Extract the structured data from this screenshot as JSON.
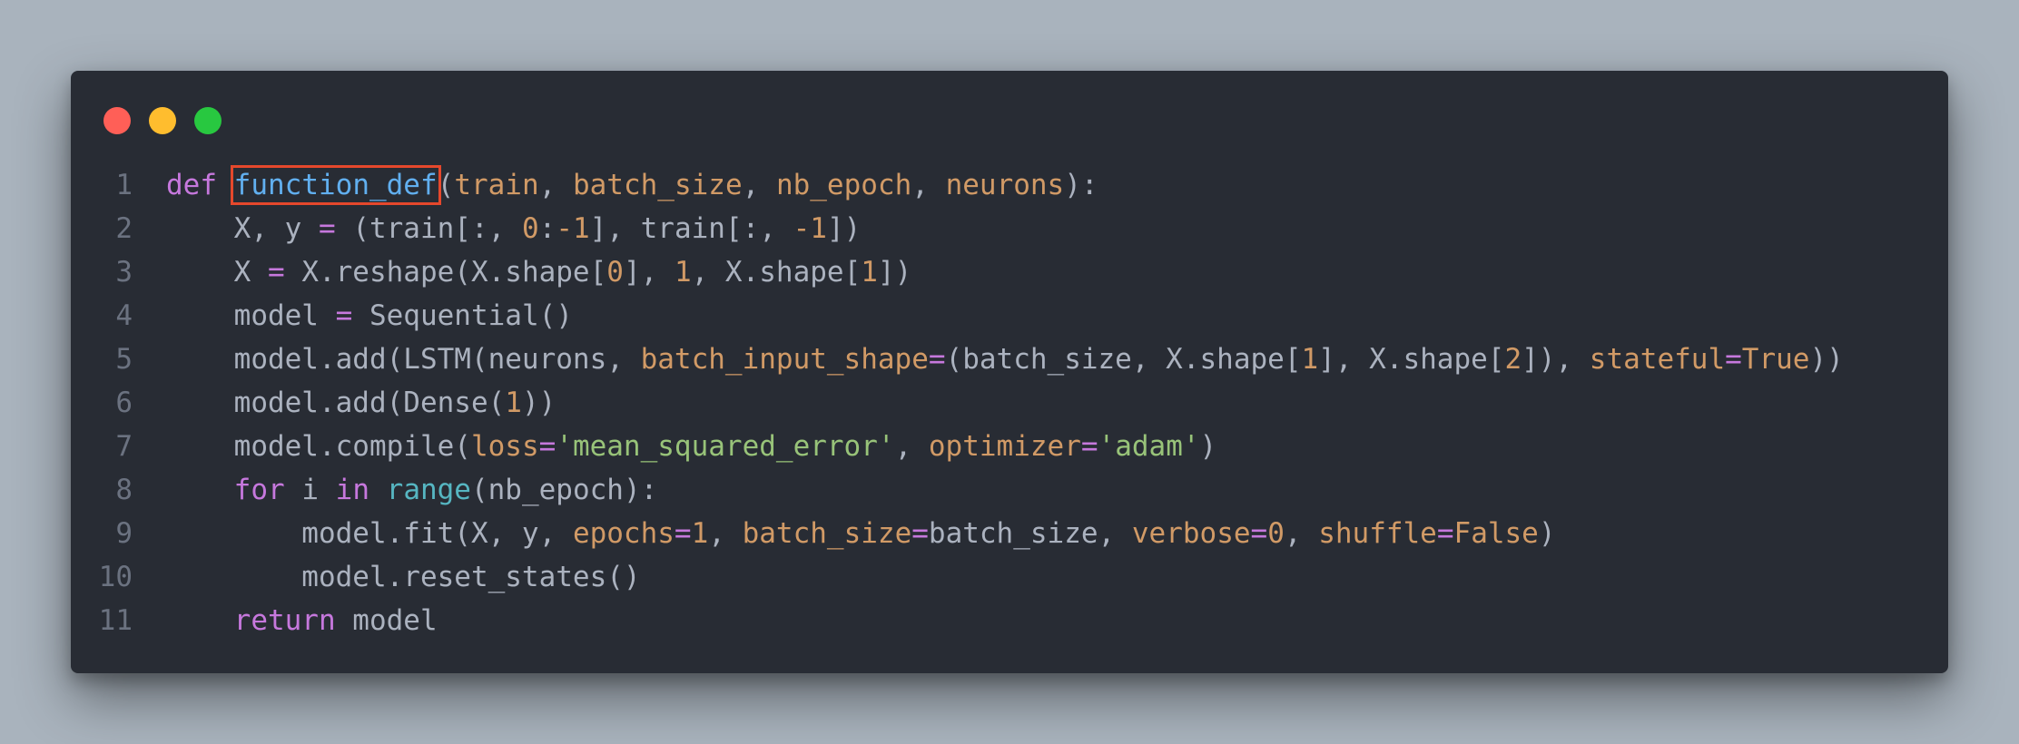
{
  "window": {
    "controls": [
      "close",
      "minimize",
      "maximize"
    ],
    "colors": {
      "close": "#ff5f57",
      "minimize": "#ffbd2e",
      "maximize": "#28c840",
      "background": "#282c34",
      "highlight_box": "#e5482c"
    }
  },
  "code": {
    "highlighted_token": "function_def",
    "lines": [
      {
        "n": "1",
        "tokens": [
          {
            "t": "def",
            "k": "kw"
          },
          {
            "t": " "
          },
          {
            "t": "function_def",
            "k": "fn",
            "hl": true
          },
          {
            "t": "("
          },
          {
            "t": "train",
            "k": "pa"
          },
          {
            "t": ", "
          },
          {
            "t": "batch_size",
            "k": "pa"
          },
          {
            "t": ", "
          },
          {
            "t": "nb_epoch",
            "k": "pa"
          },
          {
            "t": ", "
          },
          {
            "t": "neurons",
            "k": "pa"
          },
          {
            "t": "):"
          }
        ]
      },
      {
        "n": "2",
        "tokens": [
          {
            "t": "    X, y "
          },
          {
            "t": "=",
            "k": "op"
          },
          {
            "t": " (train[:, "
          },
          {
            "t": "0",
            "k": "nu"
          },
          {
            "t": ":"
          },
          {
            "t": "-1",
            "k": "nu"
          },
          {
            "t": "], train[:, "
          },
          {
            "t": "-1",
            "k": "nu"
          },
          {
            "t": "])"
          }
        ]
      },
      {
        "n": "3",
        "tokens": [
          {
            "t": "    X "
          },
          {
            "t": "=",
            "k": "op"
          },
          {
            "t": " X.reshape(X.shape["
          },
          {
            "t": "0",
            "k": "nu"
          },
          {
            "t": "], "
          },
          {
            "t": "1",
            "k": "nu"
          },
          {
            "t": ", X.shape["
          },
          {
            "t": "1",
            "k": "nu"
          },
          {
            "t": "])"
          }
        ]
      },
      {
        "n": "4",
        "tokens": [
          {
            "t": "    model "
          },
          {
            "t": "=",
            "k": "op"
          },
          {
            "t": " Sequential()"
          }
        ]
      },
      {
        "n": "5",
        "tokens": [
          {
            "t": "    model.add(LSTM(neurons, "
          },
          {
            "t": "batch_input_shape",
            "k": "pa"
          },
          {
            "t": "=",
            "k": "op"
          },
          {
            "t": "(batch_size, X.shape["
          },
          {
            "t": "1",
            "k": "nu"
          },
          {
            "t": "], X.shape["
          },
          {
            "t": "2",
            "k": "nu"
          },
          {
            "t": "]), "
          },
          {
            "t": "stateful",
            "k": "pa"
          },
          {
            "t": "=",
            "k": "op"
          },
          {
            "t": "True",
            "k": "nu"
          },
          {
            "t": "))"
          }
        ]
      },
      {
        "n": "6",
        "tokens": [
          {
            "t": "    model.add(Dense("
          },
          {
            "t": "1",
            "k": "nu"
          },
          {
            "t": "))"
          }
        ]
      },
      {
        "n": "7",
        "tokens": [
          {
            "t": "    model.compile("
          },
          {
            "t": "loss",
            "k": "pa"
          },
          {
            "t": "=",
            "k": "op"
          },
          {
            "t": "'mean_squared_error'",
            "k": "st"
          },
          {
            "t": ", "
          },
          {
            "t": "optimizer",
            "k": "pa"
          },
          {
            "t": "=",
            "k": "op"
          },
          {
            "t": "'adam'",
            "k": "st"
          },
          {
            "t": ")"
          }
        ]
      },
      {
        "n": "8",
        "tokens": [
          {
            "t": "    "
          },
          {
            "t": "for",
            "k": "kw"
          },
          {
            "t": " i "
          },
          {
            "t": "in",
            "k": "kw"
          },
          {
            "t": " "
          },
          {
            "t": "range",
            "k": "bi"
          },
          {
            "t": "(nb_epoch):"
          }
        ]
      },
      {
        "n": "9",
        "tokens": [
          {
            "t": "        model.fit(X, y, "
          },
          {
            "t": "epochs",
            "k": "pa"
          },
          {
            "t": "=",
            "k": "op"
          },
          {
            "t": "1",
            "k": "nu"
          },
          {
            "t": ", "
          },
          {
            "t": "batch_size",
            "k": "pa"
          },
          {
            "t": "=",
            "k": "op"
          },
          {
            "t": "batch_size, "
          },
          {
            "t": "verbose",
            "k": "pa"
          },
          {
            "t": "=",
            "k": "op"
          },
          {
            "t": "0",
            "k": "nu"
          },
          {
            "t": ", "
          },
          {
            "t": "shuffle",
            "k": "pa"
          },
          {
            "t": "=",
            "k": "op"
          },
          {
            "t": "False",
            "k": "nu"
          },
          {
            "t": ")"
          }
        ]
      },
      {
        "n": "10",
        "tokens": [
          {
            "t": "        model.reset_states()"
          }
        ]
      },
      {
        "n": "11",
        "tokens": [
          {
            "t": "    "
          },
          {
            "t": "return",
            "k": "kw"
          },
          {
            "t": " model"
          }
        ]
      }
    ]
  }
}
